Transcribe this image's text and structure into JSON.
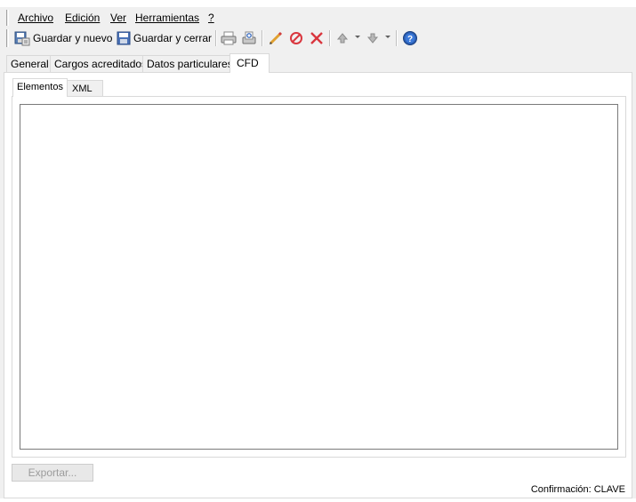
{
  "menu": {
    "items": [
      {
        "label": "Archivo"
      },
      {
        "label": "Edición"
      },
      {
        "label": "Ver"
      },
      {
        "label": "Herramientas"
      },
      {
        "label": "?"
      }
    ]
  },
  "toolbar": {
    "save_new_label": "Guardar y nuevo",
    "save_close_label": "Guardar y cerrar",
    "icons": [
      "save-new-icon",
      "save-close-icon",
      "print-icon",
      "print-preview-icon",
      "edit-icon",
      "cancel-icon",
      "delete-icon",
      "move-up-icon",
      "move-down-icon",
      "help-icon"
    ]
  },
  "tabs": {
    "outer": [
      {
        "label": "General"
      },
      {
        "label": "Cargos acreditados"
      },
      {
        "label": "Datos particulares"
      },
      {
        "label": "CFD"
      }
    ],
    "active_outer": "CFD",
    "inner": [
      {
        "label": "Elementos"
      },
      {
        "label": "XML"
      }
    ],
    "active_inner": "Elementos"
  },
  "actions": {
    "export_label": "Exportar..."
  },
  "status": {
    "confirmation": "Confirmación: CLAVE"
  },
  "colors": {
    "window_bg": "#f0f0f0",
    "panel_bg": "#ffffff",
    "accent_blue": "#2a5db0",
    "cancel_red": "#d9363e"
  }
}
